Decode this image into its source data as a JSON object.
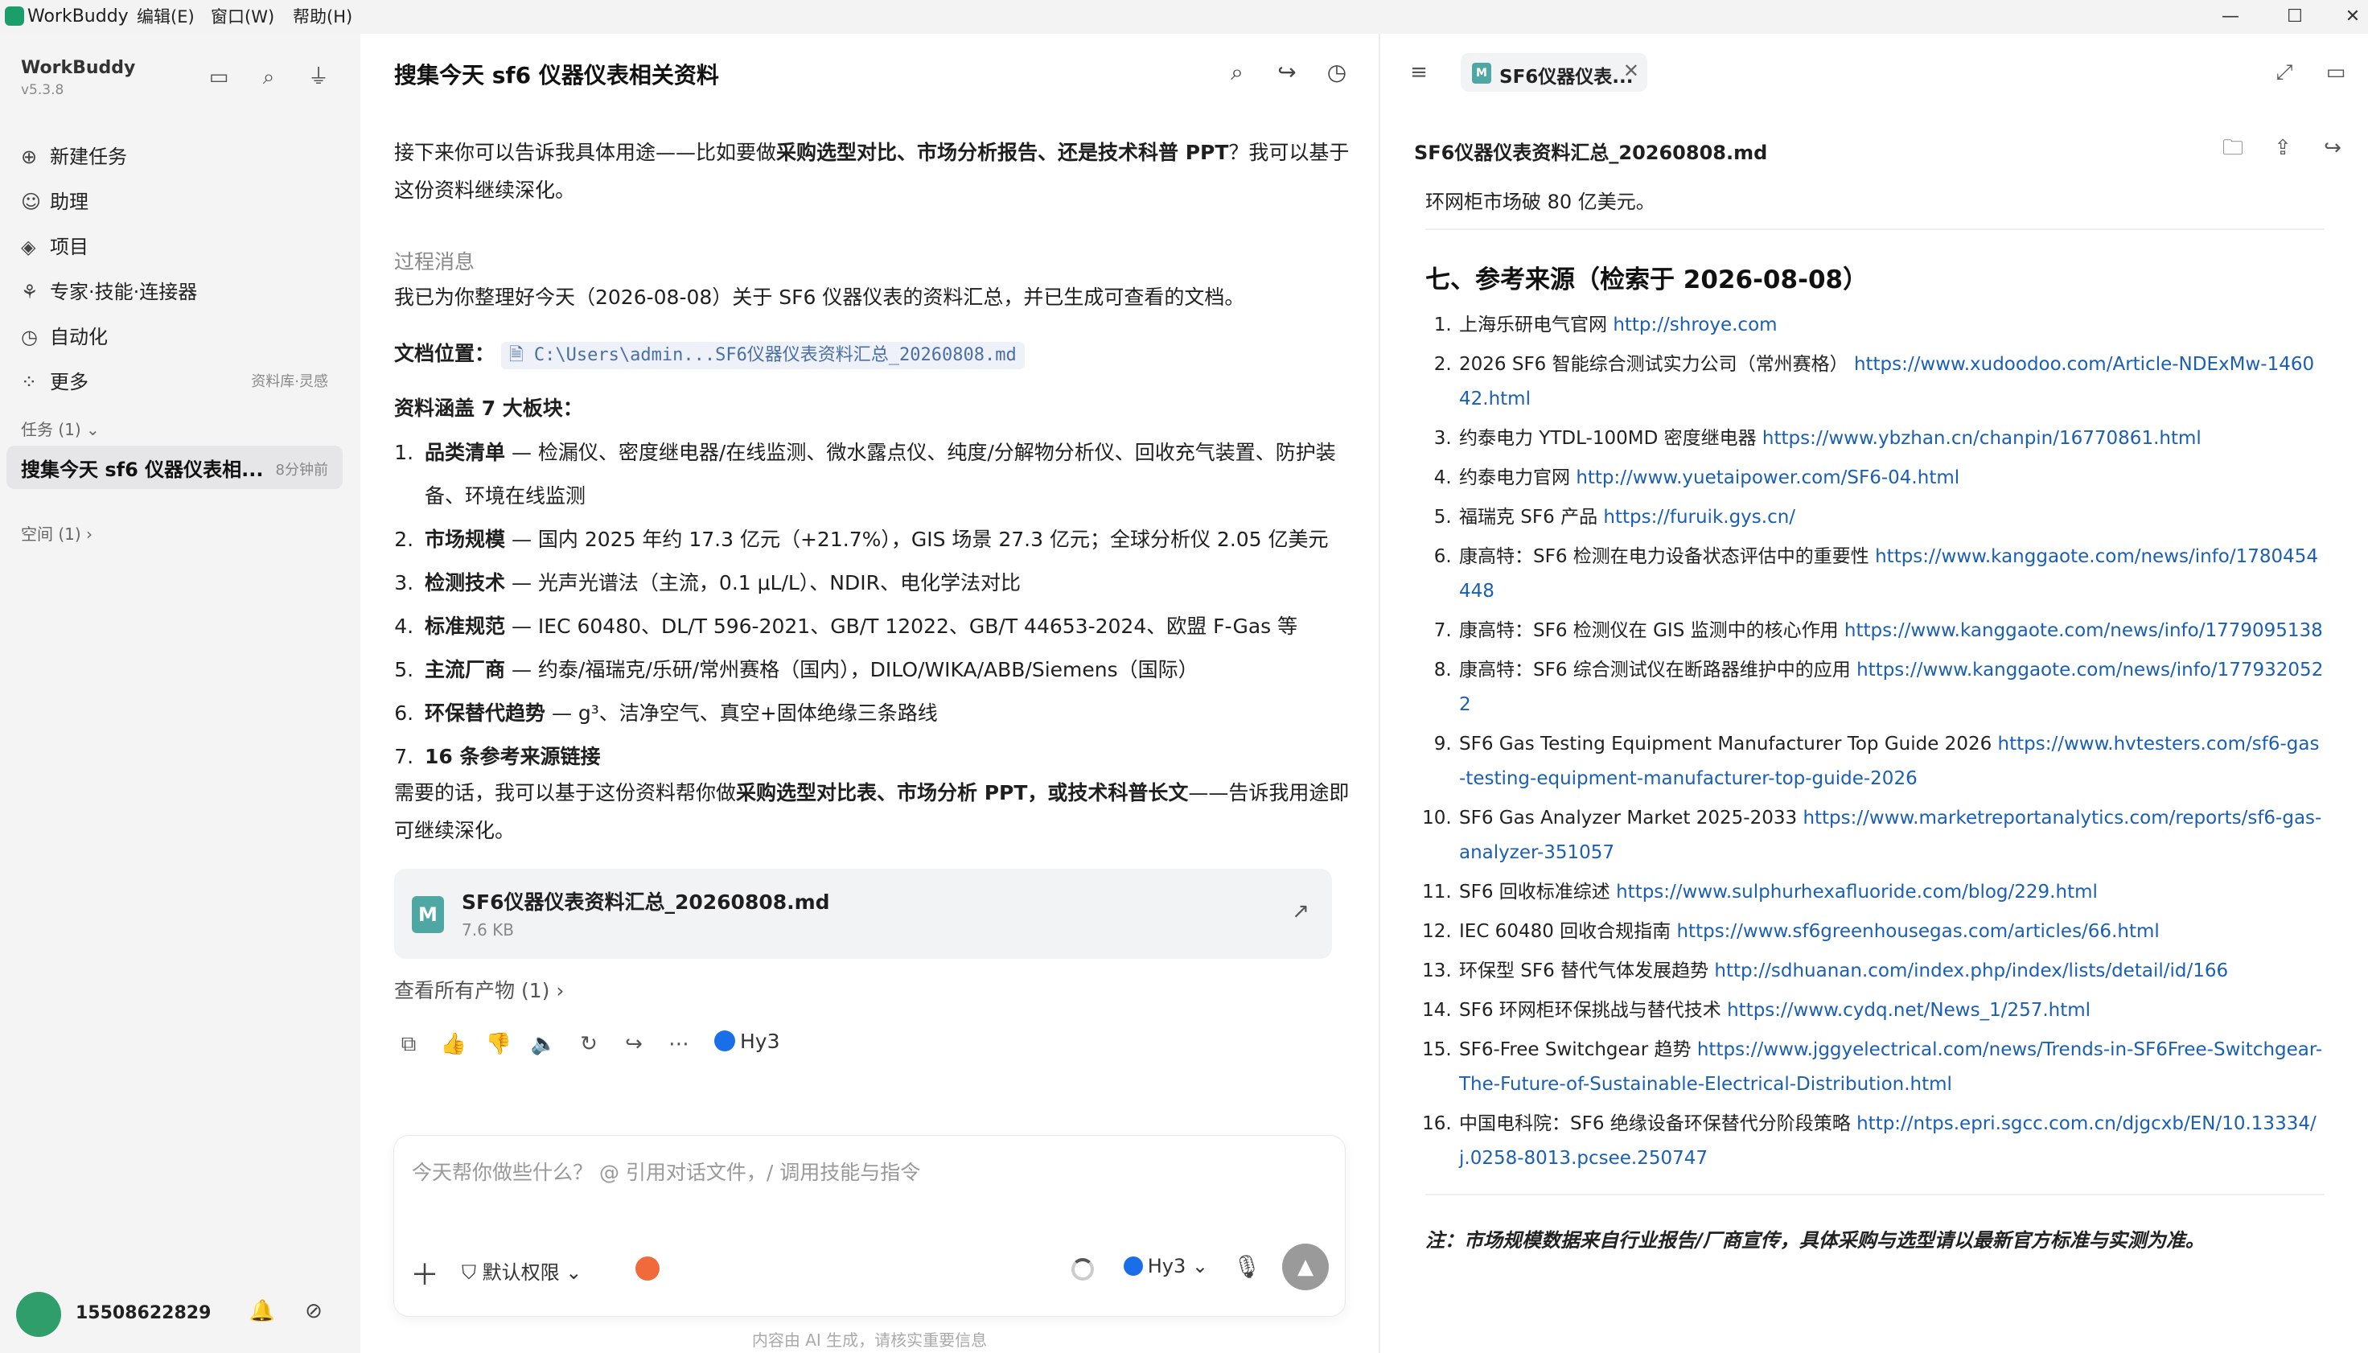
{
  "titlebar": {
    "app_name": "WorkBuddy",
    "menus": [
      "编辑(E)",
      "窗口(W)",
      "帮助(H)"
    ],
    "minimize": "—",
    "maximize": "☐",
    "close": "✕"
  },
  "sidebar": {
    "brand": "WorkBuddy",
    "version": "v5.3.8",
    "nav": [
      {
        "icon": "plus-circle-icon",
        "glyph": "⊕",
        "label": "新建任务"
      },
      {
        "icon": "assistant-icon",
        "glyph": "☺",
        "label": "助理"
      },
      {
        "icon": "project-icon",
        "glyph": "◈",
        "label": "项目"
      },
      {
        "icon": "expert-icon",
        "glyph": "⚘",
        "label": "专家·技能·连接器"
      },
      {
        "icon": "automation-icon",
        "glyph": "◷",
        "label": "自动化"
      },
      {
        "icon": "more-icon",
        "glyph": "⁘",
        "label": "更多",
        "sub": "资料库·灵感"
      }
    ],
    "tasks_header": "任务 (1)",
    "task": {
      "title": "搜集今天 sf6 仪器仪表相...",
      "time": "8分钟前"
    },
    "spaces_header": "空间 (1)",
    "user_id": "15508622829"
  },
  "chat": {
    "title": "搜集今天 sf6 仪器仪表相关资料",
    "intro_a": "接下来你可以告诉我具体用途——比如要做",
    "intro_b": "采购选型对比、市场分析报告、还是技术科普 PPT",
    "intro_c": "？我可以基于这份资料继续深化。",
    "process_label": "过程消息",
    "process_text": "我已为你整理好今天（2026-08-08）关于 SF6 仪器仪表的资料汇总，并已生成可查看的文档。",
    "doc_location_label": "文档位置：",
    "doc_path": "C:\\Users\\admin...SF6仪器仪表资料汇总_20260808.md",
    "coverage_label": "资料涵盖 7 大板块：",
    "blocks": [
      {
        "head": "品类清单",
        "body": " — 检漏仪、密度继电器/在线监测、微水露点仪、纯度/分解物分析仪、回收充气装置、防护装备、环境在线监测"
      },
      {
        "head": "市场规模",
        "body": " — 国内 2025 年约 17.3 亿元（+21.7%），GIS 场景 27.3 亿元；全球分析仪 2.05 亿美元"
      },
      {
        "head": "检测技术",
        "body": " — 光声光谱法（主流，0.1 μL/L）、NDIR、电化学法对比"
      },
      {
        "head": "标准规范",
        "body": " — IEC 60480、DL/T 596-2021、GB/T 12022、GB/T 44653-2024、欧盟 F-Gas 等"
      },
      {
        "head": "主流厂商",
        "body": " — 约泰/福瑞克/乐研/常州赛格（国内），DILO/WIKA/ABB/Siemens（国际）"
      },
      {
        "head": "环保替代趋势",
        "body": " — g³、洁净空气、真空+固体绝缘三条路线"
      },
      {
        "head": "16 条参考来源链接",
        "body": ""
      }
    ],
    "closing_a": "需要的话，我可以基于这份资料帮你做",
    "closing_b": "采购选型对比表、市场分析 PPT，或技术科普长文",
    "closing_c": "——告诉我用途即可继续深化。",
    "file_card": {
      "icon_letter": "M",
      "name": "SF6仪器仪表资料汇总_20260808.md",
      "size": "7.6 KB"
    },
    "all_outputs": "查看所有产物 (1)",
    "model_tag": "Hy3",
    "composer": {
      "placeholder": "今天帮你做些什么？ @ 引用对话文件，/ 调用技能与指令",
      "permission": "默认权限",
      "model": "Hy3"
    },
    "disclaimer": "内容由 AI 生成，请核实重要信息"
  },
  "panel": {
    "tab_name": "SF6仪器仪表...",
    "file_name": "SF6仪器仪表资料汇总_20260808.md",
    "lead_line": "环网柜市场破 80 亿美元。",
    "section_title": "七、参考来源（检索于 2026-08-08）",
    "refs": [
      {
        "text": "上海乐研电气官网 ",
        "url": "http://shroye.com"
      },
      {
        "text": "2026 SF6 智能综合测试实力公司（常州赛格） ",
        "url": "https://www.xudoodoo.com/Article-NDExMw-146042.html"
      },
      {
        "text": "约泰电力 YTDL-100MD 密度继电器 ",
        "url": "https://www.ybzhan.cn/chanpin/16770861.html"
      },
      {
        "text": "约泰电力官网 ",
        "url": "http://www.yuetaipower.com/SF6-04.html"
      },
      {
        "text": "福瑞克 SF6 产品 ",
        "url": "https://furuik.gys.cn/"
      },
      {
        "text": "康高特：SF6 检测在电力设备状态评估中的重要性 ",
        "url": "https://www.kanggaote.com/news/info/1780454448"
      },
      {
        "text": "康高特：SF6 检测仪在 GIS 监测中的核心作用 ",
        "url": "https://www.kanggaote.com/news/info/1779095138"
      },
      {
        "text": "康高特：SF6 综合测试仪在断路器维护中的应用 ",
        "url": "https://www.kanggaote.com/news/info/1779320522"
      },
      {
        "text": "SF6 Gas Testing Equipment Manufacturer Top Guide 2026 ",
        "url": "https://www.hvtesters.com/sf6-gas-testing-equipment-manufacturer-top-guide-2026"
      },
      {
        "text": "SF6 Gas Analyzer Market 2025-2033 ",
        "url": "https://www.marketreportanalytics.com/reports/sf6-gas-analyzer-351057"
      },
      {
        "text": "SF6 回收标准综述 ",
        "url": "https://www.sulphurhexafluoride.com/blog/229.html"
      },
      {
        "text": "IEC 60480 回收合规指南 ",
        "url": "https://www.sf6greenhousegas.com/articles/66.html"
      },
      {
        "text": "环保型 SF6 替代气体发展趋势 ",
        "url": "http://sdhuanan.com/index.php/index/lists/detail/id/166"
      },
      {
        "text": "SF6 环网柜环保挑战与替代技术 ",
        "url": "https://www.cydq.net/News_1/257.html"
      },
      {
        "text": "SF6-Free Switchgear 趋势 ",
        "url": "https://www.jggyelectrical.com/news/Trends-in-SF6Free-Switchgear-The-Future-of-Sustainable-Electrical-Distribution.html"
      },
      {
        "text": "中国电科院：SF6 绝缘设备环保替代分阶段策略 ",
        "url": "http://ntps.epri.sgcc.com.cn/djgcxb/EN/10.13334/j.0258-8013.pcsee.250747"
      }
    ],
    "note": "注：市场规模数据来自行业报告/厂商宣传，具体采购与选型请以最新官方标准与实测为准。"
  }
}
